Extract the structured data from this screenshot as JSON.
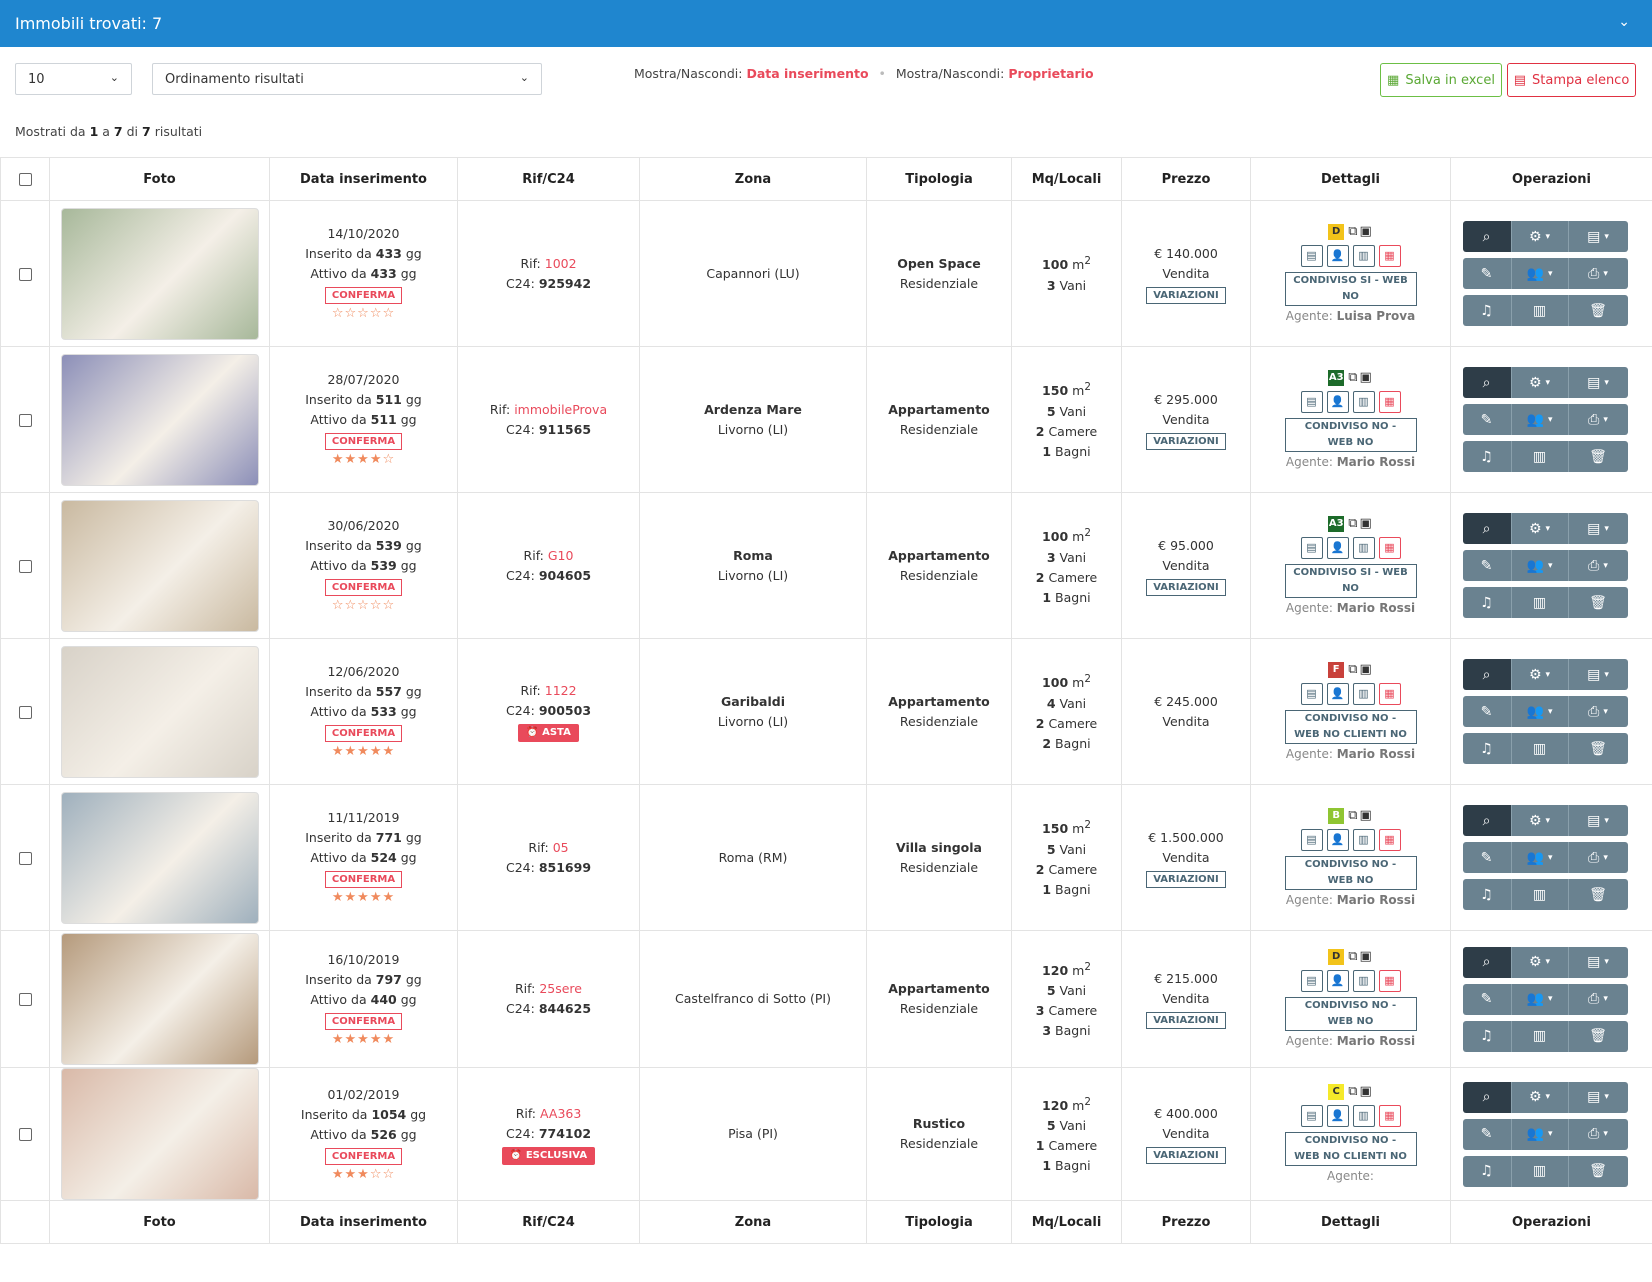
{
  "header": {
    "title": "Immobili trovati: 7"
  },
  "controls": {
    "per_page": "10",
    "order": "Ordinamento risultati",
    "toggle1_label": "Mostra/Nascondi:",
    "toggle1_link": "Data inserimento",
    "toggle2_label": "Mostra/Nascondi:",
    "toggle2_link": "Proprietario",
    "excel": "Salva in excel",
    "pdf": "Stampa elenco"
  },
  "summary": {
    "prefix": "Mostrati da",
    "from": "1",
    "mid": "a",
    "to": "7",
    "of": "di",
    "total": "7",
    "suffix": "risultati"
  },
  "columns": [
    "Foto",
    "Data inserimento",
    "Rif/C24",
    "Zona",
    "Tipologia",
    "Mq/Locali",
    "Prezzo",
    "Dettagli",
    "Operazioni"
  ],
  "labels": {
    "inserito": "Inserito da",
    "attivo": "Attivo da",
    "gg": "gg",
    "rif": "Rif:",
    "c24": "C24:",
    "conferma": "CONFERMA",
    "variazioni": "VARIAZIONI",
    "agente": "Agente:",
    "vani": "Vani",
    "camere": "Camere",
    "bagni": "Bagni",
    "unit": "m"
  },
  "colors": {
    "header_bg": "#1f86cf",
    "accent_red": "#e94a5b",
    "slate": "#4a6675"
  },
  "rows": [
    {
      "date": "14/10/2020",
      "ins": "433",
      "att": "433",
      "stars": "☆☆☆☆☆",
      "rif": "1002",
      "c24": "925942",
      "badge": "",
      "zone1": "",
      "zone2": "Capannori (LU)",
      "type1": "Open Space",
      "type2": "Residenziale",
      "mq": "100",
      "vani": "3",
      "camere": "",
      "bagni": "",
      "price": "€ 140.000",
      "contract": "Vendita",
      "var": true,
      "cls": "D",
      "clsColor": "#f2c31a",
      "condiv": "CONDIVISO SI - WEB NO",
      "agent": "Luisa Prova",
      "photo": "#a7b89a"
    },
    {
      "date": "28/07/2020",
      "ins": "511",
      "att": "511",
      "stars": "★★★★☆",
      "rif": "immobileProva",
      "c24": "911565",
      "badge": "",
      "zone1": "Ardenza Mare",
      "zone2": "Livorno (LI)",
      "type1": "Appartamento",
      "type2": "Residenziale",
      "mq": "150",
      "vani": "5",
      "camere": "2",
      "bagni": "1",
      "price": "€ 295.000",
      "contract": "Vendita",
      "var": true,
      "cls": "A3",
      "clsColor": "#1d6b2a",
      "condiv": "CONDIVISO NO - WEB NO",
      "agent": "Mario Rossi",
      "photo": "#8c8fb8"
    },
    {
      "date": "30/06/2020",
      "ins": "539",
      "att": "539",
      "stars": "☆☆☆☆☆",
      "rif": "G10",
      "c24": "904605",
      "badge": "",
      "zone1": "Roma",
      "zone2": "Livorno (LI)",
      "type1": "Appartamento",
      "type2": "Residenziale",
      "mq": "100",
      "vani": "3",
      "camere": "2",
      "bagni": "1",
      "price": "€ 95.000",
      "contract": "Vendita",
      "var": true,
      "cls": "A3",
      "clsColor": "#1d6b2a",
      "condiv": "CONDIVISO SI - WEB NO",
      "agent": "Mario Rossi",
      "photo": "#c9b9a0"
    },
    {
      "date": "12/06/2020",
      "ins": "557",
      "att": "533",
      "stars": "★★★★★",
      "rif": "1122",
      "c24": "900503",
      "badge": "ASTA",
      "zone1": "Garibaldi",
      "zone2": "Livorno (LI)",
      "type1": "Appartamento",
      "type2": "Residenziale",
      "mq": "100",
      "vani": "4",
      "camere": "2",
      "bagni": "2",
      "price": "€ 245.000",
      "contract": "Vendita",
      "var": false,
      "cls": "F",
      "clsColor": "#c8413b",
      "condiv": "CONDIVISO NO - WEB NO CLIENTI NO",
      "agent": "Mario Rossi",
      "photo": "#d8d2c8"
    },
    {
      "date": "11/11/2019",
      "ins": "771",
      "att": "524",
      "stars": "★★★★★",
      "rif": "05",
      "c24": "851699",
      "badge": "",
      "zone1": "",
      "zone2": "Roma (RM)",
      "type1": "Villa singola",
      "type2": "Residenziale",
      "mq": "150",
      "vani": "5",
      "camere": "2",
      "bagni": "1",
      "price": "€ 1.500.000",
      "contract": "Vendita",
      "var": true,
      "cls": "B",
      "clsColor": "#8fc532",
      "condiv": "CONDIVISO NO - WEB NO",
      "agent": "Mario Rossi",
      "photo": "#9fb0bd"
    },
    {
      "date": "16/10/2019",
      "ins": "797",
      "att": "440",
      "stars": "★★★★★",
      "rif": "25sere",
      "c24": "844625",
      "badge": "",
      "zone1": "",
      "zone2": "Castelfranco di Sotto (PI)",
      "type1": "Appartamento",
      "type2": "Residenziale",
      "mq": "120",
      "vani": "5",
      "camere": "3",
      "bagni": "3",
      "price": "€ 215.000",
      "contract": "Vendita",
      "var": true,
      "cls": "D",
      "clsColor": "#f2c31a",
      "condiv": "CONDIVISO NO - WEB NO",
      "agent": "Mario Rossi",
      "photo": "#b59a7c"
    },
    {
      "date": "01/02/2019",
      "ins": "1054",
      "att": "526",
      "stars": "★★★☆☆",
      "rif": "AA363",
      "c24": "774102",
      "badge": "ESCLUSIVA",
      "zone1": "",
      "zone2": "Pisa (PI)",
      "type1": "Rustico",
      "type2": "Residenziale",
      "mq": "120",
      "vani": "5",
      "camere": "1",
      "bagni": "1",
      "price": "€ 400.000",
      "contract": "Vendita",
      "var": true,
      "cls": "C",
      "clsColor": "#f5e92a",
      "condiv": "CONDIVISO NO - WEB NO CLIENTI NO",
      "agent": "",
      "photo": "#d9b9a8"
    }
  ]
}
